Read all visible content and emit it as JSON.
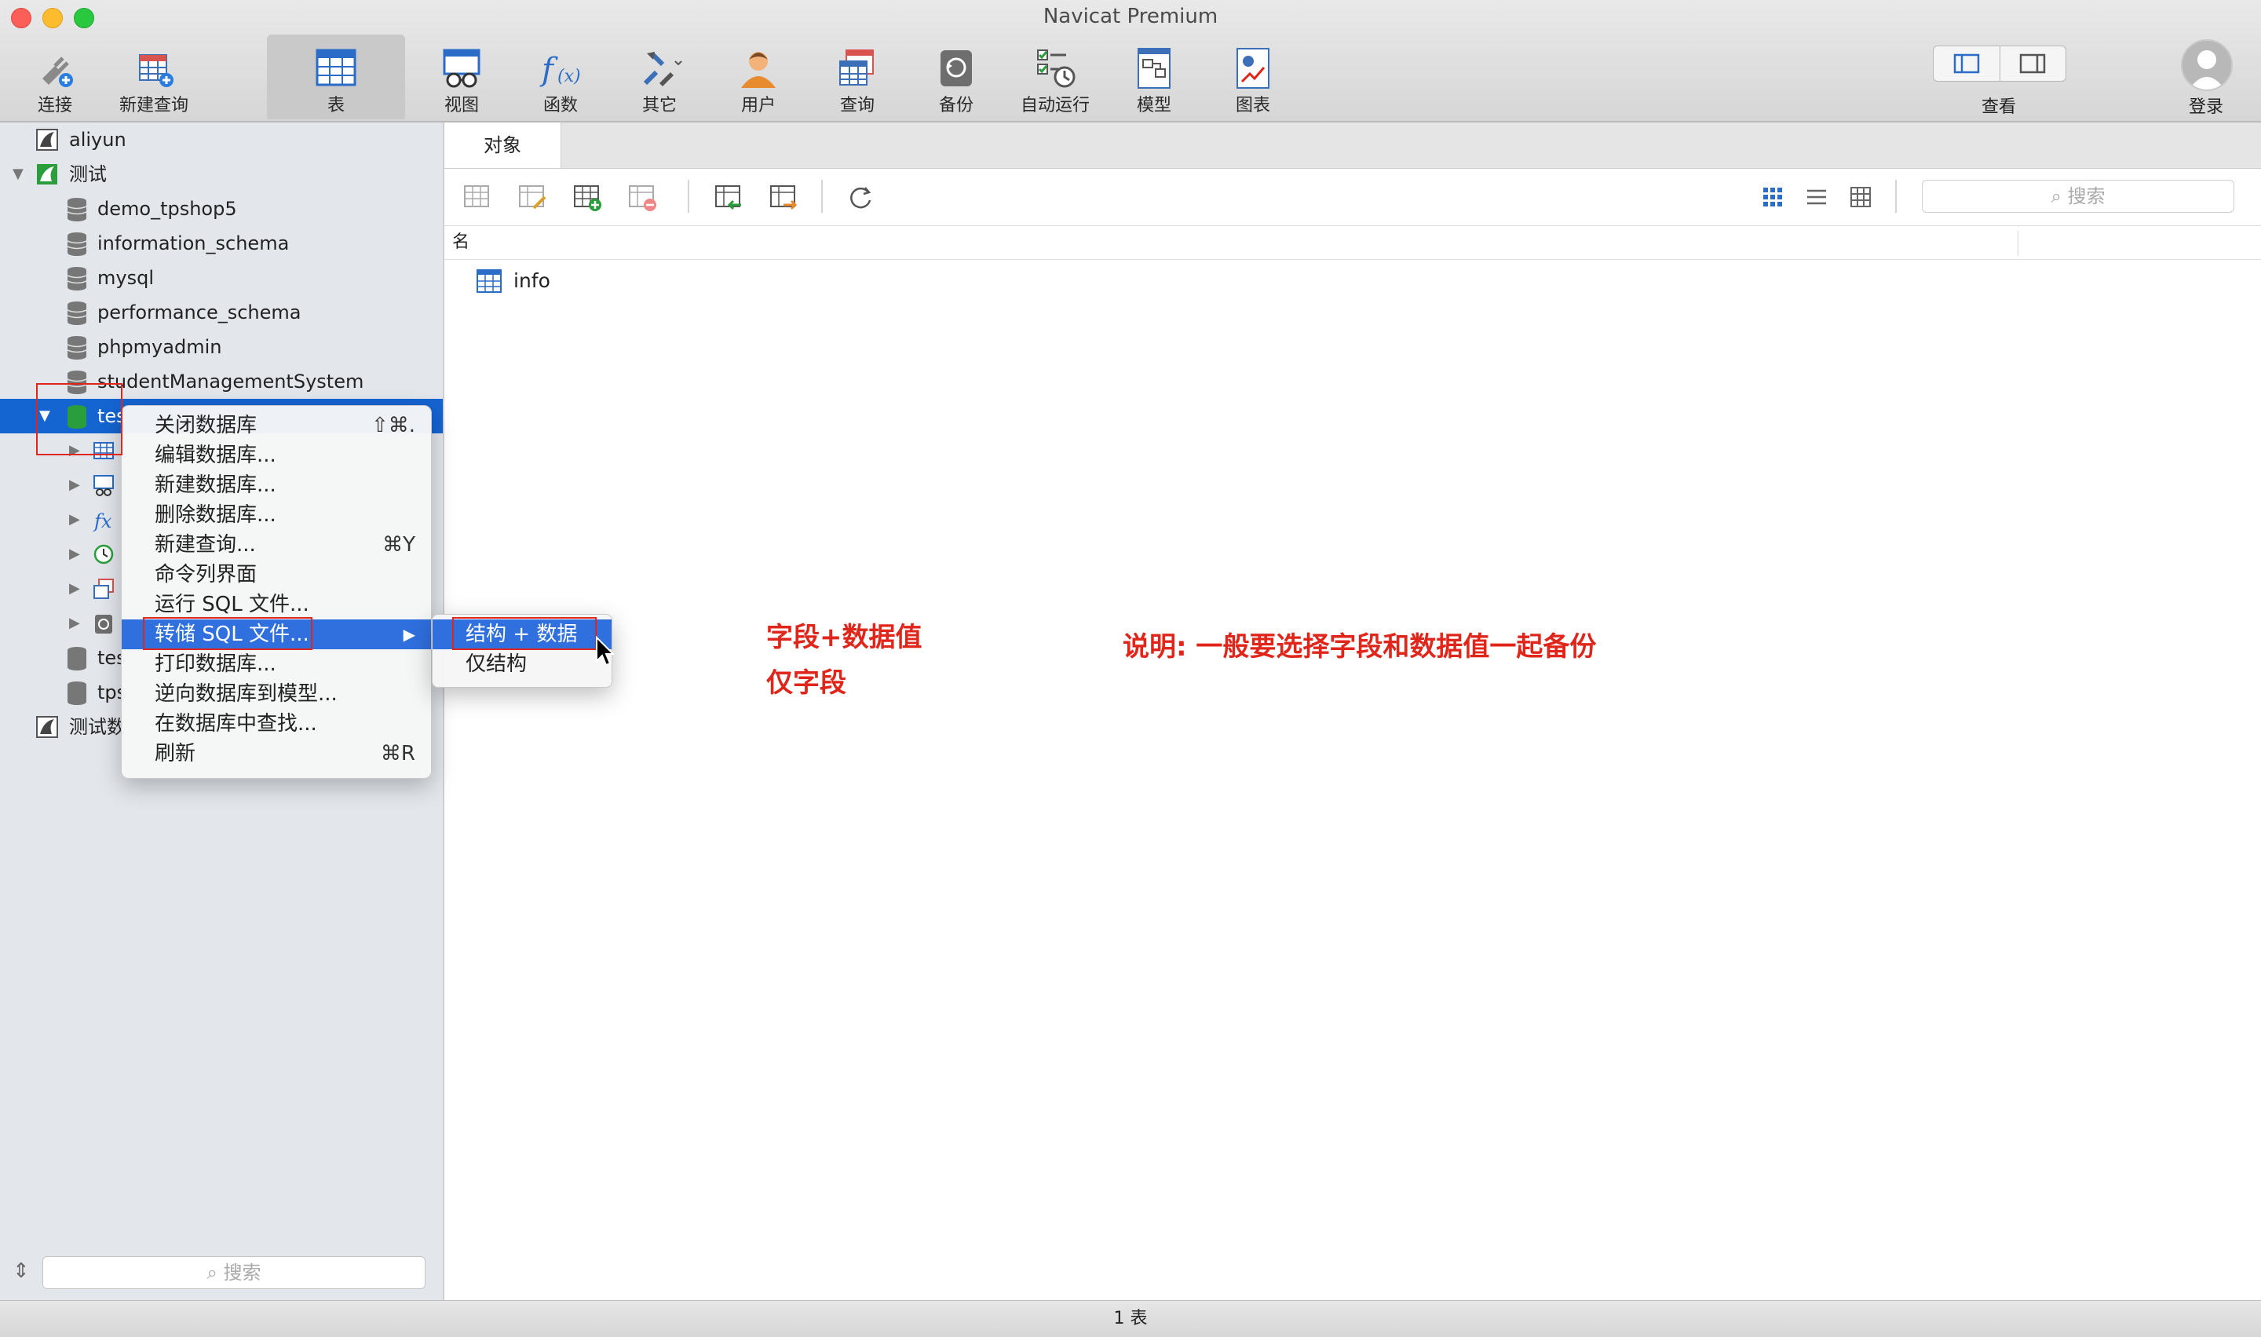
{
  "window": {
    "title": "Navicat Premium"
  },
  "toolbar": {
    "items": [
      {
        "label": "连接",
        "icon": "connection-icon"
      },
      {
        "label": "新建查询",
        "icon": "new-query-icon"
      },
      {
        "label": "表",
        "icon": "table-icon",
        "active": true
      },
      {
        "label": "视图",
        "icon": "view-icon"
      },
      {
        "label": "函数",
        "icon": "function-icon"
      },
      {
        "label": "其它",
        "icon": "tools-icon"
      },
      {
        "label": "用户",
        "icon": "user-icon"
      },
      {
        "label": "查询",
        "icon": "query-icon"
      },
      {
        "label": "备份",
        "icon": "backup-icon"
      },
      {
        "label": "自动运行",
        "icon": "automation-icon"
      },
      {
        "label": "模型",
        "icon": "model-icon"
      },
      {
        "label": "图表",
        "icon": "chart-icon"
      }
    ],
    "view_label": "查看",
    "login_label": "登录"
  },
  "sidebar": {
    "connections": [
      {
        "label": "aliyun"
      },
      {
        "label": "测试"
      },
      {
        "label": "测试数"
      }
    ],
    "databases": [
      "demo_tpshop5",
      "information_schema",
      "mysql",
      "performance_schema",
      "phpmyadmin",
      "studentManagementSystem",
      "tes",
      "tes",
      "tps"
    ],
    "search_placeholder": "搜索"
  },
  "main": {
    "tab": "对象",
    "search_placeholder": "搜索",
    "column_name": "名",
    "objects": [
      {
        "name": "info"
      }
    ]
  },
  "context_menu": {
    "items": [
      {
        "label": "关闭数据库",
        "shortcut": "⇧⌘."
      },
      {
        "label": "编辑数据库...",
        "shortcut": ""
      },
      {
        "label": "新建数据库...",
        "shortcut": ""
      },
      {
        "label": "删除数据库...",
        "shortcut": ""
      },
      {
        "label": "新建查询...",
        "shortcut": "⌘Y"
      },
      {
        "label": "命令列界面",
        "shortcut": ""
      },
      {
        "label": "运行 SQL 文件...",
        "shortcut": ""
      },
      {
        "label": "转储 SQL 文件...",
        "shortcut": "▶",
        "highlighted": true
      },
      {
        "label": "打印数据库...",
        "shortcut": ""
      },
      {
        "label": "逆向数据库到模型...",
        "shortcut": ""
      },
      {
        "label": "在数据库中查找...",
        "shortcut": ""
      },
      {
        "label": "刷新",
        "shortcut": "⌘R"
      }
    ],
    "submenu": [
      {
        "label": "结构 + 数据",
        "highlighted": true
      },
      {
        "label": "仅结构"
      }
    ]
  },
  "annotations": {
    "note1": "字段+数据值",
    "note2": "仅字段",
    "note3": "说明: 一般要选择字段和数据值一起备份"
  },
  "status": {
    "text": "1 表"
  },
  "colors": {
    "accent": "#2f6fde",
    "selection": "#1464d2",
    "annotation": "#e0261b"
  }
}
